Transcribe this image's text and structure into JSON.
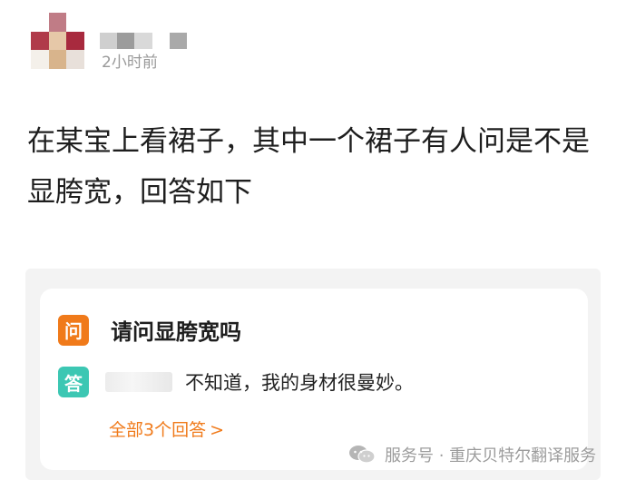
{
  "post": {
    "timestamp": "2小时前",
    "text": "在某宝上看裙子，其中一个裙子有人问是不是显胯宽，回答如下"
  },
  "qa_card": {
    "question_badge": "问",
    "question": "请问显胯宽吗",
    "answer_badge": "答",
    "answer": "不知道，我的身材很曼妙。",
    "all_answers_link": "全部3个回答",
    "all_answers_chevron": ">"
  },
  "watermark": {
    "icon": "wechat-icon",
    "text": "服务号 · 重庆贝特尔翻译服务"
  },
  "colors": {
    "accent_orange": "#f07a1a",
    "answer_badge_teal": "#3cc7b3",
    "card_background": "#f3f3f3"
  }
}
